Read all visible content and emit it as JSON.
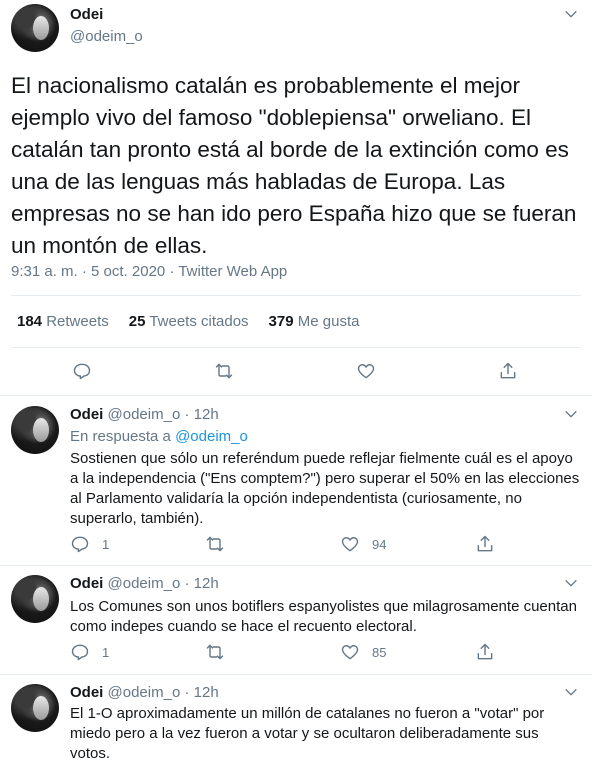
{
  "main_tweet": {
    "name": "Odei",
    "handle": "@odeim_o",
    "text": "El nacionalismo catalán es probablemente el mejor ejemplo vivo del famoso \"doblepiensa\" orweliano. El catalán tan pronto está al borde de la extinción como es una de las lenguas más habladas de Europa. Las empresas no se han ido pero España hizo que se fueran un montón de ellas.",
    "meta": "9:31 a. m. · 5 oct. 2020 · Twitter Web App",
    "stats": {
      "retweets_count": "184",
      "retweets_label": "Retweets",
      "quotes_count": "25",
      "quotes_label": "Tweets citados",
      "likes_count": "379",
      "likes_label": "Me gusta"
    }
  },
  "replies": [
    {
      "name": "Odei",
      "handle": "@odeim_o",
      "dot": "·",
      "time": "12h",
      "reply_to_prefix": "En respuesta a",
      "reply_to_mention": "@odeim_o",
      "text": "Sostienen que sólo un referéndum puede reflejar fielmente cuál es el apoyo a la independencia (\"Ens comptem?\") pero superar el 50% en las elecciones al Parlamento validaría la opción independentista (curiosamente, no superarlo, también).",
      "reply_count": "1",
      "retweet_count": "",
      "like_count": "94"
    },
    {
      "name": "Odei",
      "handle": "@odeim_o",
      "dot": "·",
      "time": "12h",
      "text": "Los Comunes son unos botiflers espanyolistes que milagrosamente cuentan como indepes cuando se hace el recuento electoral.",
      "reply_count": "1",
      "retweet_count": "",
      "like_count": "85"
    },
    {
      "name": "Odei",
      "handle": "@odeim_o",
      "dot": "·",
      "time": "12h",
      "text": "El 1-O aproximadamente un millón de catalanes no fueron a \"votar\" por miedo pero a la vez fueron a votar y se ocultaron deliberadamente sus votos."
    }
  ],
  "icons": {
    "reply": "reply-icon",
    "retweet": "retweet-icon",
    "like": "heart-icon",
    "share": "share-icon",
    "caret": "chevron-down-icon"
  },
  "colors": {
    "text": "#14171a",
    "secondary": "#657786",
    "link": "#1b95e0",
    "divider": "#e6ecf0"
  }
}
